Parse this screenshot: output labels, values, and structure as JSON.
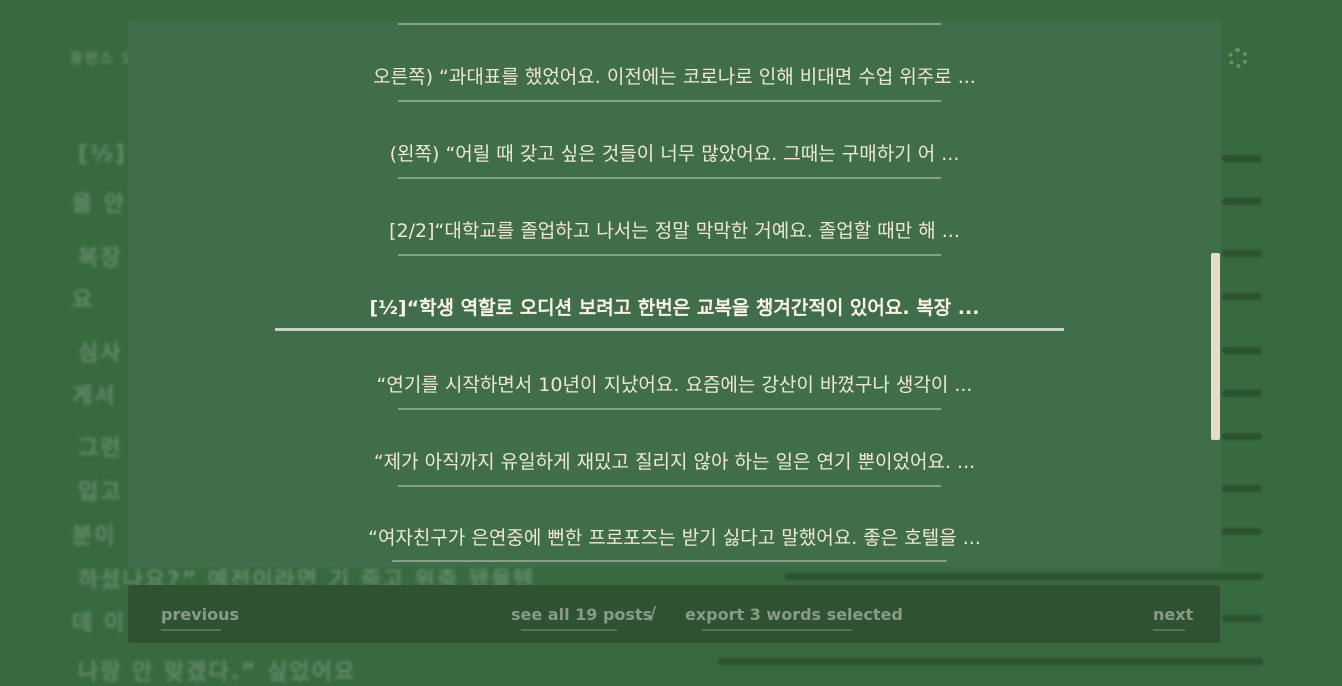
{
  "posts": [
    {
      "text": "오른쪽) “과대표를 했었어요. 이전에는 코로나로 인해 비대면 수업 위주로 ..."
    },
    {
      "text": "(왼쪽) “어릴 때 갖고 싶은 것들이 너무 많았어요. 그때는 구매하기 어 ..."
    },
    {
      "text": "[2/2]“대학교를 졸업하고 나서는 정말 막막한 거예요. 졸업할 때만 해 ..."
    },
    {
      "text": "[½]“학생 역할로 오디션 보려고 한번은 교복을 챙겨간적이 있어요. 복장 ..."
    },
    {
      "text": "“연기를 시작하면서 10년이 지났어요. 요즘에는 강산이 바꼈구나 생각이 ..."
    },
    {
      "text": "“제가 아직까지 유일하게 재밌고 질리지 않아 하는 일은 연기 뿐이었어요. ..."
    },
    {
      "text": "“여자친구가 은연중에 뻔한 프로포즈는 받기 싫다고 말했어요. 좋은 호텔을 ..."
    }
  ],
  "footer": {
    "previous": "previous",
    "see_all": "see all 19 posts",
    "separator": "/",
    "export": "export 3 words selected",
    "next": "next"
  },
  "background": {
    "nav_text": "휴먼스 오",
    "lines": [
      "[½]“",
      "을 안",
      "복장",
      "요",
      "심사",
      "게서",
      "그런",
      "입고",
      "분이",
      "하셨나요?” 예전이라면 기 죽고 위축 됐을텐",
      "데 이",
      "나랑 안 맞겠다.” 싶었어요"
    ]
  },
  "colors": {
    "background": "#386a40",
    "modal": "#406e4a",
    "footer": "#2f5233",
    "post_text": "#f0e6d6",
    "scroll_thumb": "#e8d9c9"
  }
}
